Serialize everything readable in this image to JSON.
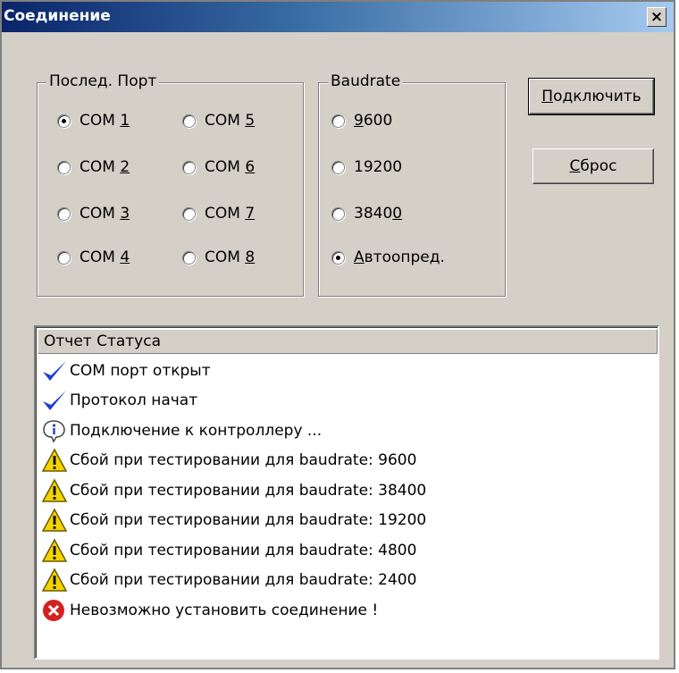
{
  "window": {
    "title": "Соединение",
    "close_label": "×"
  },
  "port_group": {
    "label": "Послед. Порт",
    "ports": [
      {
        "prefix": "COM ",
        "key": "1",
        "checked": true
      },
      {
        "prefix": "COM ",
        "key": "5",
        "checked": false
      },
      {
        "prefix": "COM ",
        "key": "2",
        "checked": false
      },
      {
        "prefix": "COM ",
        "key": "6",
        "checked": false
      },
      {
        "prefix": "COM ",
        "key": "3",
        "checked": false
      },
      {
        "prefix": "COM ",
        "key": "7",
        "checked": false
      },
      {
        "prefix": "COM ",
        "key": "4",
        "checked": false
      },
      {
        "prefix": "COM ",
        "key": "8",
        "checked": false
      }
    ]
  },
  "baud_group": {
    "label": "Baudrate",
    "rates": [
      {
        "pre": "",
        "key": "9",
        "post": "600",
        "checked": false
      },
      {
        "pre": "19200",
        "key": "",
        "post": "",
        "checked": false
      },
      {
        "pre": "3840",
        "key": "0",
        "post": "",
        "checked": false
      },
      {
        "pre": "",
        "key": "А",
        "post": "втоопред.",
        "checked": true
      }
    ]
  },
  "buttons": {
    "connect": {
      "key": "П",
      "rest": "одключить"
    },
    "reset": {
      "key": "С",
      "rest": "брос"
    }
  },
  "status": {
    "header": "Отчет Статуса",
    "items": [
      {
        "icon": "check",
        "text": "COM порт открыт"
      },
      {
        "icon": "check",
        "text": "Протокол начат"
      },
      {
        "icon": "info",
        "text": "Подключение к контроллеру ..."
      },
      {
        "icon": "warning",
        "text": "Сбой при тестировании для baudrate: 9600"
      },
      {
        "icon": "warning",
        "text": "Сбой при тестировании для baudrate: 38400"
      },
      {
        "icon": "warning",
        "text": "Сбой при тестировании для baudrate: 19200"
      },
      {
        "icon": "warning",
        "text": "Сбой при тестировании для baudrate: 4800"
      },
      {
        "icon": "warning",
        "text": "Сбой при тестировании для baudrate: 2400"
      },
      {
        "icon": "error",
        "text": "Невозможно установить соединение !"
      }
    ]
  },
  "colors": {
    "check": "#1f3fd6",
    "warning": "#f4d400",
    "error": "#d42020",
    "info": "#2040c0"
  }
}
